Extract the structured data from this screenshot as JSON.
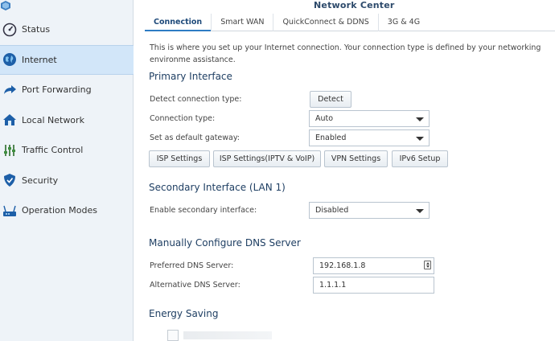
{
  "window": {
    "title": "Network Center"
  },
  "sidebar": {
    "items": [
      {
        "label": "Status",
        "icon": "gauge-icon",
        "active": false
      },
      {
        "label": "Internet",
        "icon": "globe-icon",
        "active": true
      },
      {
        "label": "Port Forwarding",
        "icon": "arrow-right-icon",
        "active": false
      },
      {
        "label": "Local Network",
        "icon": "home-icon",
        "active": false
      },
      {
        "label": "Traffic Control",
        "icon": "sliders-icon",
        "active": false
      },
      {
        "label": "Security",
        "icon": "shield-icon",
        "active": false
      },
      {
        "label": "Operation Modes",
        "icon": "router-icon",
        "active": false
      }
    ]
  },
  "tabs": [
    {
      "label": "Connection",
      "active": true
    },
    {
      "label": "Smart WAN",
      "active": false
    },
    {
      "label": "QuickConnect & DDNS",
      "active": false
    },
    {
      "label": "3G & 4G",
      "active": false
    }
  ],
  "description": "This is where you set up your Internet connection. Your connection type is defined by your networking environme assistance.",
  "primary": {
    "title": "Primary Interface",
    "detect_label": "Detect connection type:",
    "detect_button": "Detect",
    "connection_type_label": "Connection type:",
    "connection_type_value": "Auto",
    "default_gateway_label": "Set as default gateway:",
    "default_gateway_value": "Enabled",
    "buttons": {
      "isp": "ISP Settings",
      "isp_iptv": "ISP Settings(IPTV & VoIP)",
      "vpn": "VPN Settings",
      "ipv6": "IPv6 Setup"
    }
  },
  "secondary": {
    "title": "Secondary Interface (LAN 1)",
    "enable_label": "Enable secondary interface:",
    "enable_value": "Disabled"
  },
  "dns": {
    "title": "Manually Configure DNS Server",
    "preferred_label": "Preferred DNS Server:",
    "preferred_value": "192.168.1.8",
    "alternative_label": "Alternative DNS Server:",
    "alternative_value": "1.1.1.1"
  },
  "energy": {
    "title": "Energy Saving"
  },
  "colors": {
    "accent": "#2e7cc4",
    "sidebar_bg": "#eef3f8",
    "active_item": "#d2e6f9",
    "heading": "#1f3f63"
  }
}
